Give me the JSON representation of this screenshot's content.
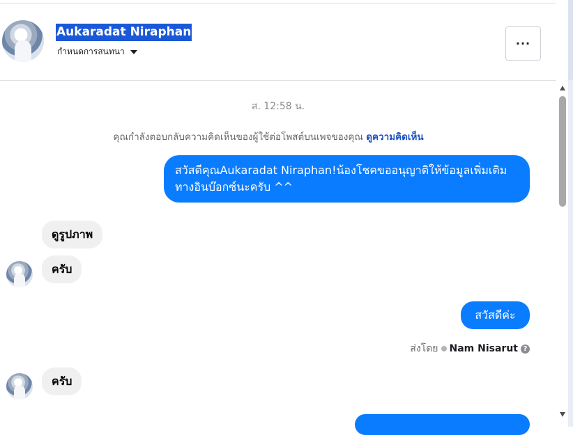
{
  "header": {
    "contact_name": "Aukaradat Niraphan",
    "subtitle": "กำหนดการสนทนา",
    "more_label": "···"
  },
  "thread": {
    "timestamp": "ส. 12:58 น.",
    "notice_text": "คุณกำลังตอบกลับความคิดเห็นของผู้ใช้ต่อโพสต์บนเพจของคุณ",
    "notice_link": "ดูความคิดเห็น",
    "messages": [
      {
        "direction": "out",
        "text": "สวัสดีคุณAukaradat Niraphan!น้องโชคขออนุญาติให้ข้อมูลเพิ่มเติมทางอินบ๊อกซ์นะครับ ^^"
      },
      {
        "direction": "in",
        "text": "ดูรูปภาพ"
      },
      {
        "direction": "in",
        "text": "ครับ"
      },
      {
        "direction": "out",
        "text": "สวัสดีค่ะ"
      },
      {
        "direction": "in",
        "text": "ครับ"
      },
      {
        "direction": "out",
        "text": ""
      }
    ],
    "sent_by_label": "ส่งโดย",
    "sent_by_name": "Nam Nisarut",
    "help_glyph": "?"
  },
  "colors": {
    "outgoing_bubble": "#0a7cff",
    "incoming_bubble": "#f0f0f0",
    "name_highlight": "#1a58d8",
    "link": "#1b4fbf"
  },
  "icons": [
    "avatar",
    "caret-down-icon",
    "more-icon",
    "sent-by-icon",
    "help-icon",
    "scroll-up-icon",
    "scroll-down-icon"
  ]
}
